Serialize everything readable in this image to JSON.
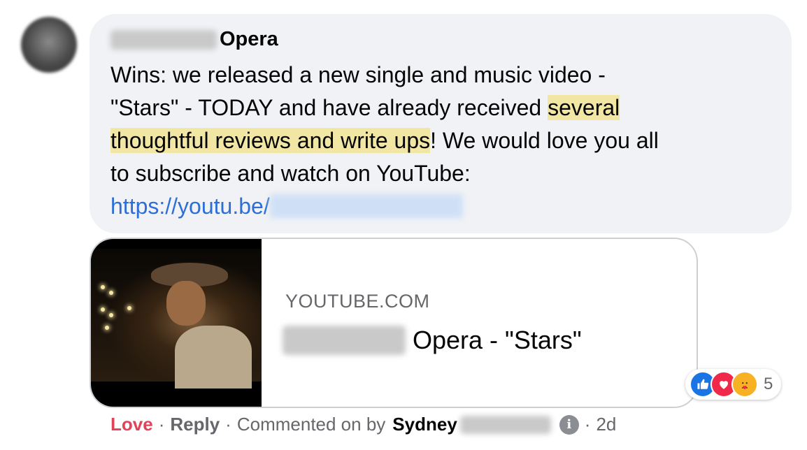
{
  "comment": {
    "author_suffix": "Opera",
    "lines": [
      {
        "parts": [
          {
            "text": "Wins: we released a new single and music video -",
            "highlight": false
          }
        ]
      },
      {
        "parts": [
          {
            "text": "\"Stars\" - TODAY and have already received ",
            "highlight": false
          },
          {
            "text": "several",
            "highlight": true
          }
        ]
      },
      {
        "parts": [
          {
            "text": "thoughtful reviews and write ups",
            "highlight": true
          },
          {
            "text": "! We would love you all",
            "highlight": false
          }
        ]
      },
      {
        "parts": [
          {
            "text": "to subscribe and watch on YouTube:",
            "highlight": false
          }
        ]
      }
    ],
    "link_text": "https://youtu.be/"
  },
  "link_card": {
    "domain": "YOUTUBE.COM",
    "title_suffix": "Opera - \"Stars\""
  },
  "reactions": {
    "icons": [
      "like-icon",
      "love-icon",
      "care-icon"
    ],
    "count": "5"
  },
  "meta": {
    "love_label": "Love",
    "reply_label": "Reply",
    "commented_on_by": "Commented on by",
    "commenter_first_name": "Sydney",
    "time": "2d",
    "separator": "·"
  },
  "colors": {
    "bubble_bg": "#f0f2f5",
    "highlight": "#f2e6a5",
    "link": "#2d6fd6",
    "love_text": "#e0445a",
    "secondary_text": "#65676b"
  }
}
